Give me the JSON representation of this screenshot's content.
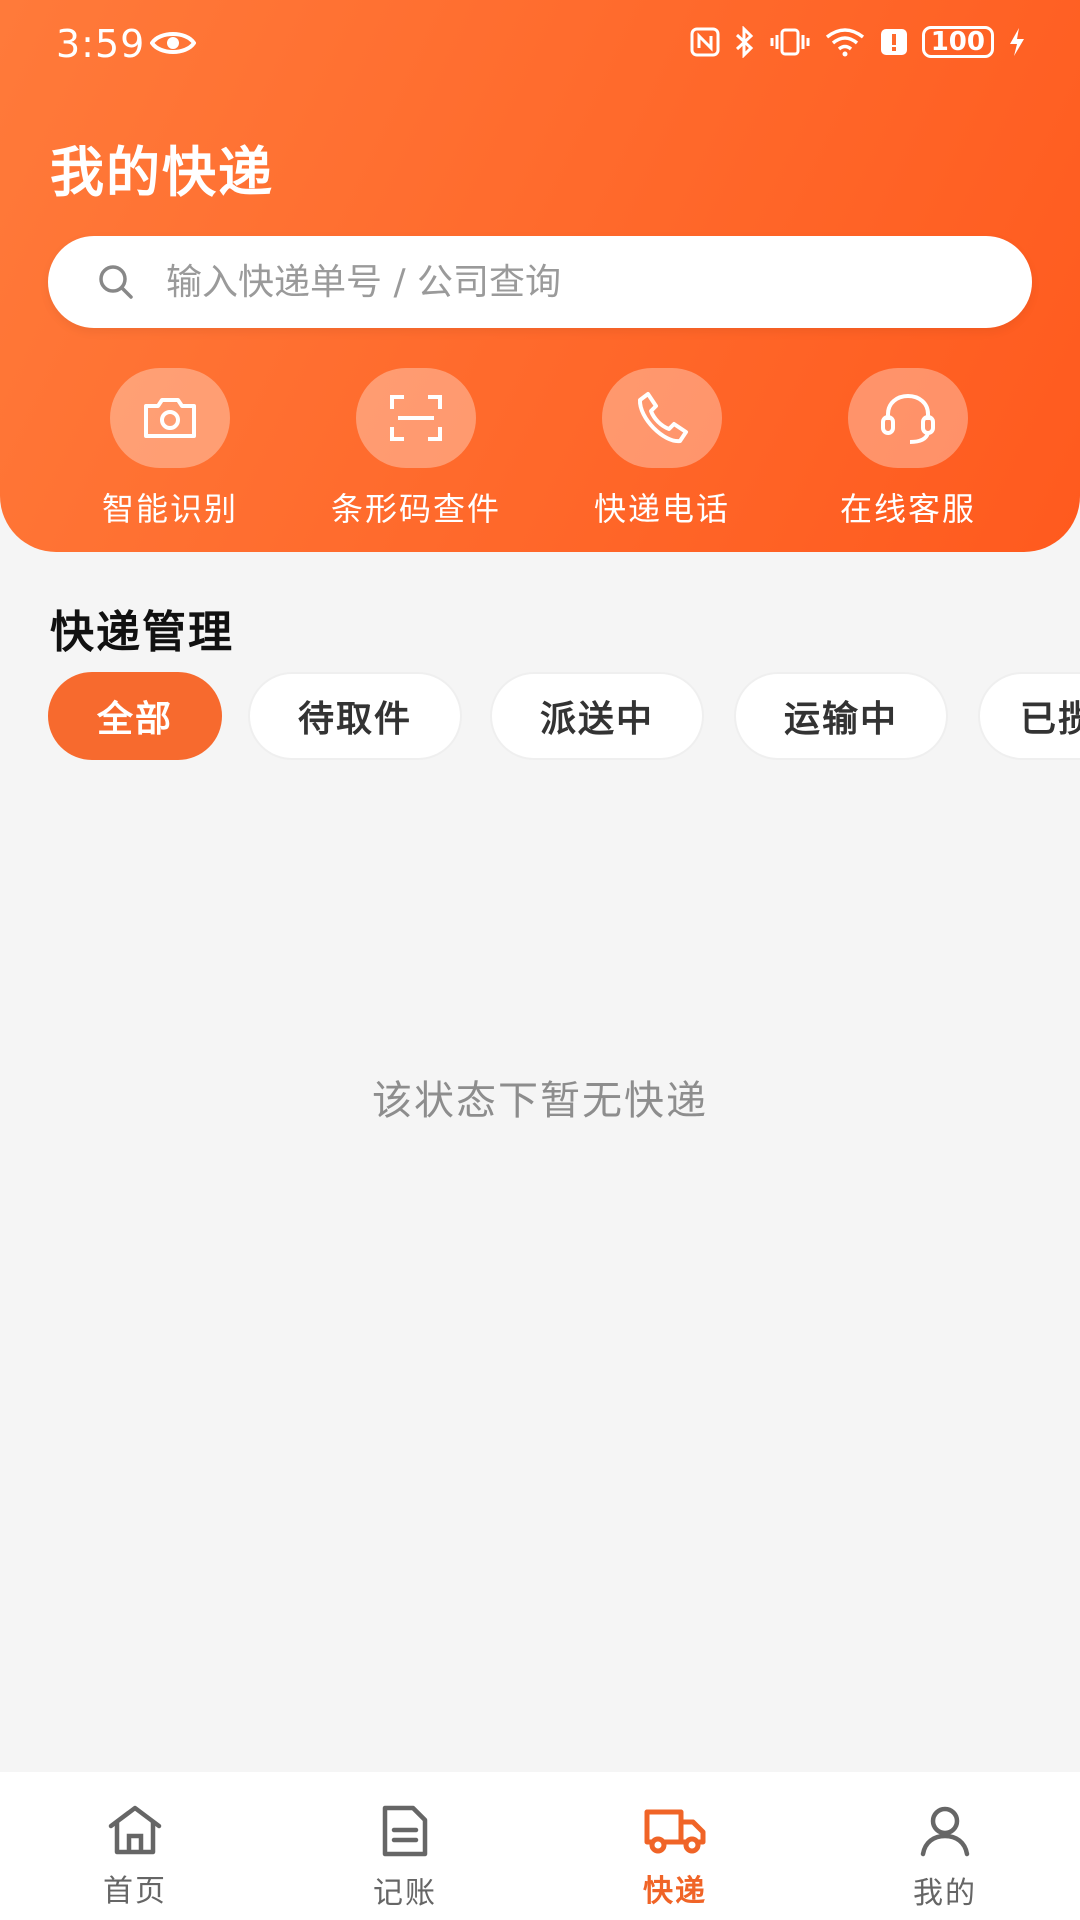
{
  "status_bar": {
    "time": "3:59",
    "battery": "100",
    "icons": [
      "eye-icon",
      "nfc-icon",
      "bluetooth-icon",
      "vibrate-icon",
      "wifi-icon",
      "alert-icon",
      "battery-icon",
      "charging-icon"
    ]
  },
  "header": {
    "title": "我的快递",
    "search_placeholder": "输入快递单号 / 公司查询",
    "quick_actions": [
      {
        "label": "智能识别",
        "icon": "camera-icon"
      },
      {
        "label": "条形码查件",
        "icon": "scan-icon"
      },
      {
        "label": "快递电话",
        "icon": "phone-icon"
      },
      {
        "label": "在线客服",
        "icon": "headset-icon"
      }
    ]
  },
  "section": {
    "title": "快递管理",
    "tabs": [
      "全部",
      "待取件",
      "派送中",
      "运输中",
      "已揽"
    ],
    "active_tab": "全部"
  },
  "empty_state": "该状态下暂无快递",
  "bottom_nav": {
    "items": [
      {
        "label": "首页",
        "icon": "home-icon"
      },
      {
        "label": "记账",
        "icon": "ledger-icon"
      },
      {
        "label": "快递",
        "icon": "truck-icon"
      },
      {
        "label": "我的",
        "icon": "user-icon"
      }
    ],
    "active": "快递"
  },
  "colors": {
    "accent": "#f76a2e",
    "header_start": "#ff7a3a",
    "header_end": "#ff5a1e"
  }
}
